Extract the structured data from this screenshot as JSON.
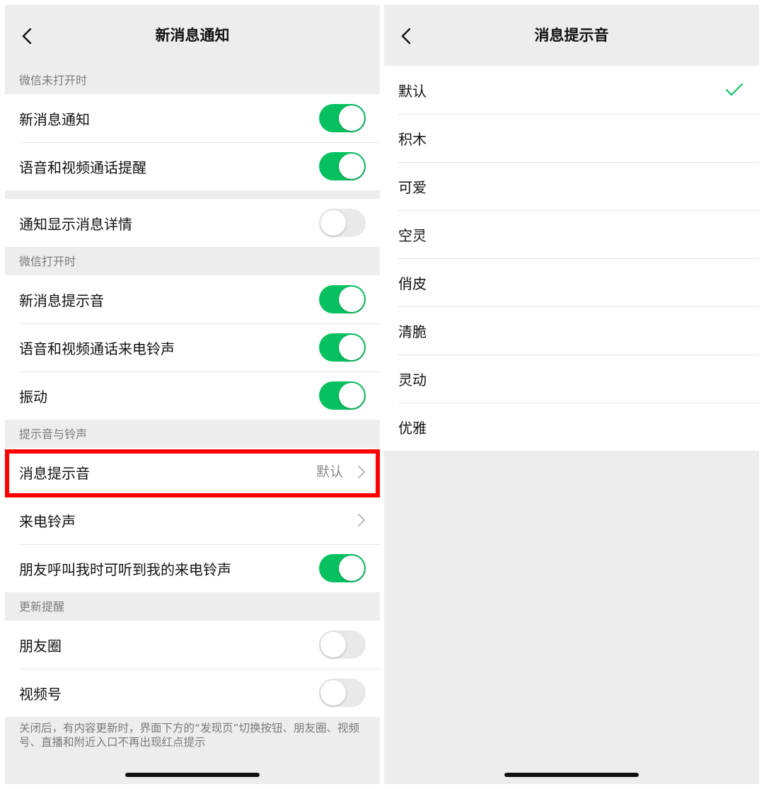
{
  "left": {
    "title": "新消息通知",
    "sections": {
      "closed_header": "微信未打开时",
      "open_header": "微信打开时",
      "sound_header": "提示音与铃声",
      "update_header": "更新提醒"
    },
    "rows": {
      "new_msg": "新消息通知",
      "call_alert": "语音和视频通话提醒",
      "show_detail": "通知显示消息详情",
      "new_msg_sound": "新消息提示音",
      "call_ringtone": "语音和视频通话来电铃声",
      "vibrate": "振动",
      "msg_sound": "消息提示音",
      "msg_sound_value": "默认",
      "ringtone": "来电铃声",
      "friend_ringtone": "朋友呼叫我时可听到我的来电铃声",
      "moments": "朋友圈",
      "channels": "视频号"
    },
    "toggles": {
      "new_msg": true,
      "call_alert": true,
      "show_detail": false,
      "new_msg_sound": true,
      "call_ringtone": true,
      "vibrate": true,
      "friend_ringtone": true,
      "moments": false,
      "channels": false
    },
    "footnote": "关闭后，有内容更新时，界面下方的“发现页”切换按钮、朋友圈、视频号、直播和附近入口不再出现红点提示"
  },
  "right": {
    "title": "消息提示音",
    "options": [
      "默认",
      "积木",
      "可爱",
      "空灵",
      "俏皮",
      "清脆",
      "灵动",
      "优雅"
    ],
    "selected_index": 0
  },
  "colors": {
    "accent_green": "#07c160",
    "highlight_red": "#ff0000",
    "background": "#ededed"
  },
  "icons": {
    "back": "chevron-left-icon",
    "disclosure": "chevron-right-icon",
    "selected": "checkmark-icon"
  }
}
